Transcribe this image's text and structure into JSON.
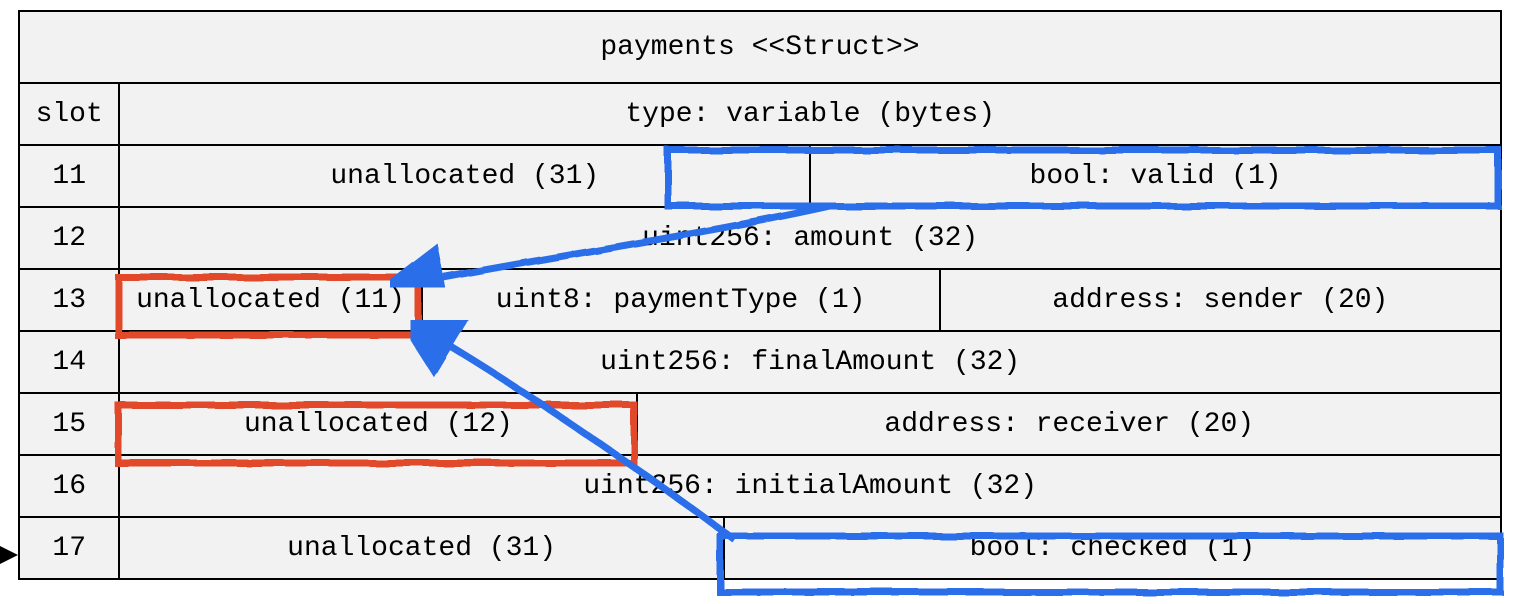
{
  "title": "payments <<Struct>>",
  "header_slot": "slot",
  "header_type": "type: variable (bytes)",
  "rows": {
    "r11": {
      "slot": "11",
      "a": "unallocated (31)",
      "b": "bool: valid (1)"
    },
    "r12": {
      "slot": "12",
      "a": "uint256: amount (32)"
    },
    "r13": {
      "slot": "13",
      "a": "unallocated (11)",
      "b": "uint8: paymentType (1)",
      "c": "address: sender (20)"
    },
    "r14": {
      "slot": "14",
      "a": "uint256: finalAmount (32)"
    },
    "r15": {
      "slot": "15",
      "a": "unallocated (12)",
      "b": "address: receiver (20)"
    },
    "r16": {
      "slot": "16",
      "a": "uint256: initialAmount (32)"
    },
    "r17": {
      "slot": "17",
      "a": "unallocated (31)",
      "b": "bool: checked (1)"
    }
  },
  "highlights": {
    "blue": [
      "slot11-bool-valid",
      "slot17-bool-checked"
    ],
    "red": [
      "slot13-unallocated",
      "slot15-unallocated"
    ]
  },
  "arrows": [
    {
      "from": "slot11-bool-valid",
      "to": "slot13-unallocated"
    },
    {
      "from": "slot17-bool-checked",
      "to": "slot13-unallocated"
    }
  ],
  "colors": {
    "blue": "#2a6eea",
    "red": "#e24a2a",
    "cell_bg": "#f2f2f2",
    "border": "#000000"
  }
}
